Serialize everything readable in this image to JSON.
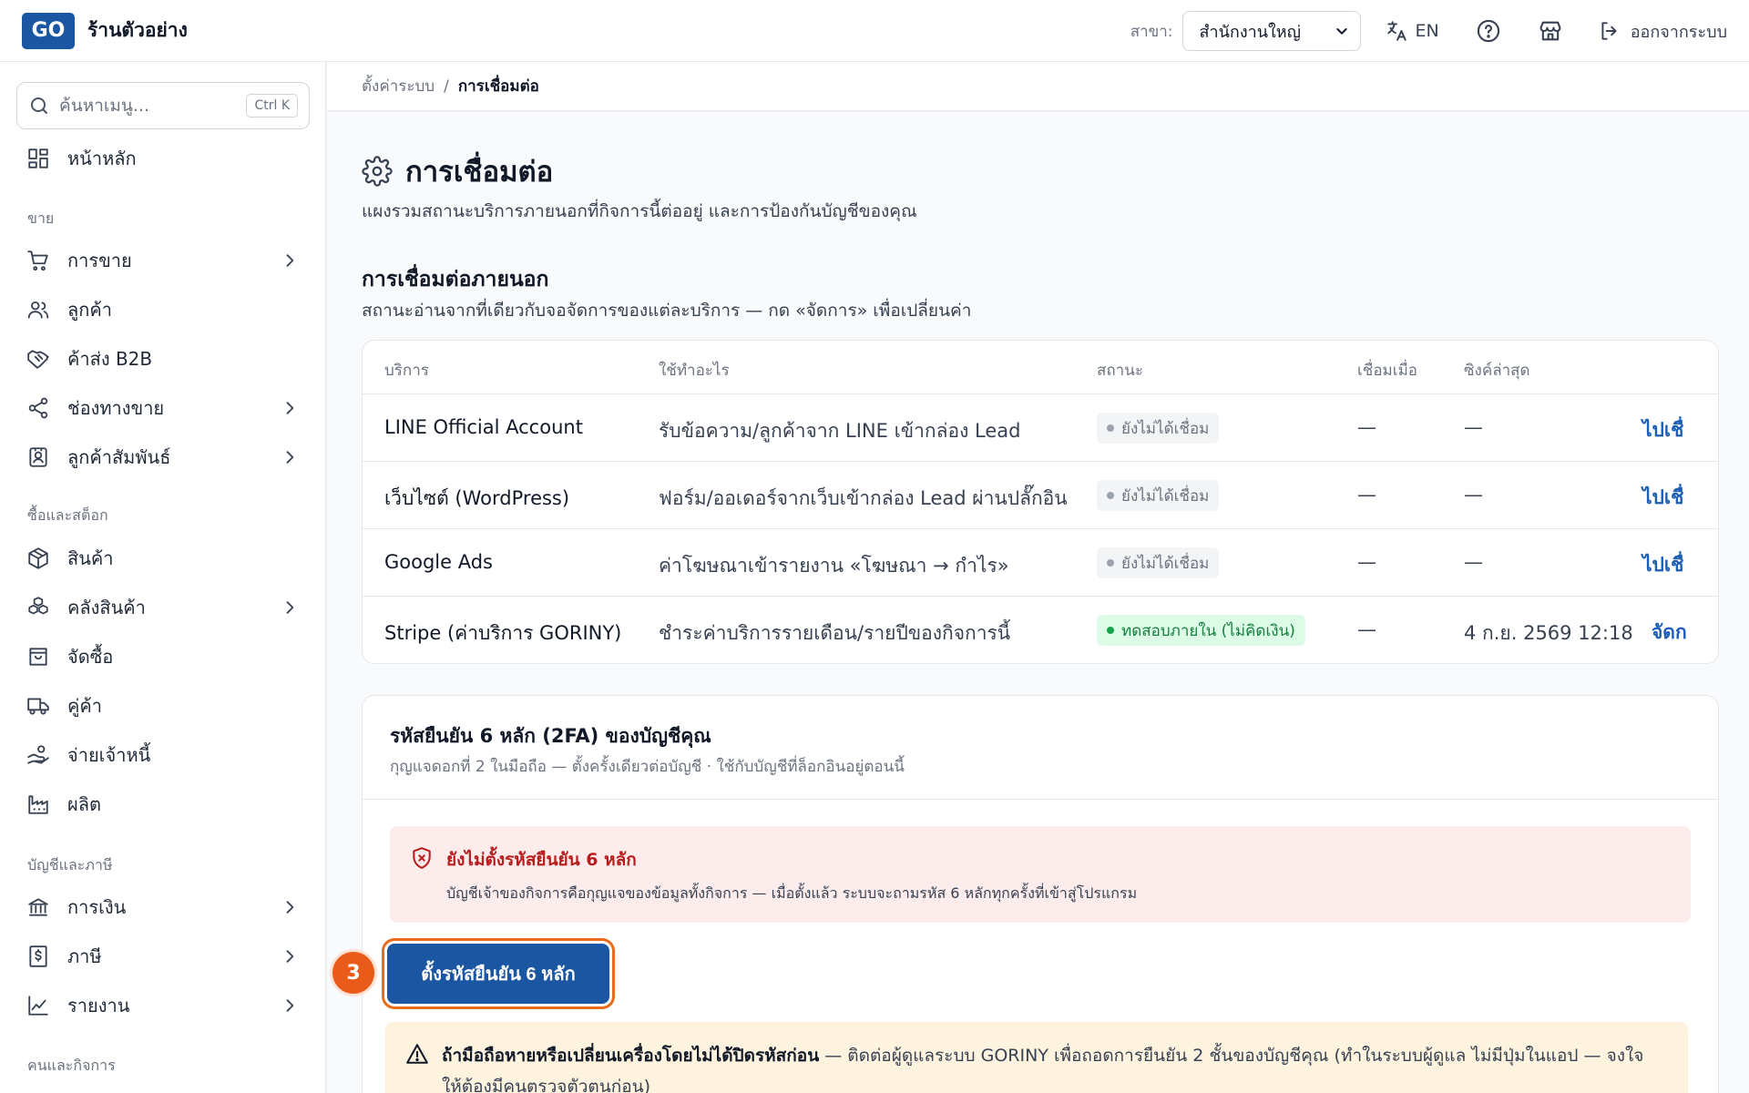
{
  "header": {
    "logo": "GO",
    "shop_name": "ร้านตัวอย่าง",
    "branch_label": "สาขา:",
    "branch_value": "สำนักงานใหญ่",
    "lang": "EN",
    "logout": "ออกจากระบบ"
  },
  "sidebar": {
    "search_placeholder": "ค้นหาเมนู...",
    "search_shortcut": "Ctrl K",
    "home": "หน้าหลัก",
    "sections": [
      "ขาย",
      "ซื้อและสต็อก",
      "บัญชีและภาษี",
      "คนและกิจการ"
    ],
    "items": [
      {
        "label": "การขาย",
        "icon": "cart-icon"
      },
      {
        "label": "ลูกค้า",
        "icon": "users-icon"
      },
      {
        "label": "ค้าส่ง B2B",
        "icon": "handshake-icon"
      },
      {
        "label": "ช่องทางขาย",
        "icon": "share-icon"
      },
      {
        "label": "ลูกค้าสัมพันธ์",
        "icon": "contact-card-icon"
      },
      {
        "label": "สินค้า",
        "icon": "box-icon"
      },
      {
        "label": "คลังสินค้า",
        "icon": "boxes-icon"
      },
      {
        "label": "จัดซื้อ",
        "icon": "bag-icon"
      },
      {
        "label": "คู่ค้า",
        "icon": "truck-icon"
      },
      {
        "label": "จ่ายเจ้าหนี้",
        "icon": "hand-coins-icon"
      },
      {
        "label": "ผลิต",
        "icon": "factory-icon"
      },
      {
        "label": "การเงิน",
        "icon": "bank-icon"
      },
      {
        "label": "ภาษี",
        "icon": "receipt-icon"
      },
      {
        "label": "รายงาน",
        "icon": "chart-line-icon"
      }
    ]
  },
  "breadcrumb": {
    "parent": "ตั้งค่าระบบ",
    "sep": "/",
    "current": "การเชื่อมต่อ"
  },
  "page": {
    "title": "การเชื่อมต่อ",
    "subtitle": "แผงรวมสถานะบริการภายนอกที่กิจการนี้ต่ออยู่ และการป้องกันบัญชีของคุณ",
    "section_title": "การเชื่อมต่อภายนอก",
    "section_sub": "สถานะอ่านจากที่เดียวกับจอจัดการของแต่ละบริการ — กด «จัดการ» เพื่อเปลี่ยนค่า"
  },
  "table": {
    "headers": [
      "บริการ",
      "ใช้ทำอะไร",
      "สถานะ",
      "เชื่อมเมื่อ",
      "ซิงค์ล่าสุด"
    ],
    "rows": [
      {
        "service": "LINE Official Account",
        "use": "รับข้อความ/ลูกค้าจาก LINE เข้ากล่อง Lead",
        "status": "ยังไม่ได้เชื่อม",
        "connected": "—",
        "synced": "—",
        "action": "ไปเชื่"
      },
      {
        "service": "เว็บไซต์ (WordPress)",
        "use": "ฟอร์ม/ออเดอร์จากเว็บเข้ากล่อง Lead ผ่านปลั๊กอิน",
        "status": "ยังไม่ได้เชื่อม",
        "connected": "—",
        "synced": "—",
        "action": "ไปเชื่"
      },
      {
        "service": "Google Ads",
        "use": "ค่าโฆษณาเข้ารายงาน «โฆษณา → กำไร»",
        "status": "ยังไม่ได้เชื่อม",
        "connected": "—",
        "synced": "—",
        "action": "ไปเชื่"
      },
      {
        "service": "Stripe (ค่าบริการ GORINY)",
        "use": "ชำระค่าบริการรายเดือน/รายปีของกิจการนี้",
        "status": "ทดสอบภายใน (ไม่คิดเงิน)",
        "connected": "—",
        "synced": "4 ก.ย. 2569 12:18",
        "action": "จัดก"
      }
    ]
  },
  "twofa": {
    "title": "รหัสยืนยัน 6 หลัก (2FA) ของบัญชีคุณ",
    "subtitle": "กุญแจดอกที่ 2 ในมือถือ — ตั้งครั้งเดียวต่อบัญชี · ใช้กับบัญชีที่ล็อกอินอยู่ตอนนี้",
    "alert_title": "ยังไม่ตั้งรหัสยืนยัน 6 หลัก",
    "alert_body": "บัญชีเจ้าของกิจการคือกุญแจของข้อมูลทั้งกิจการ — เมื่อตั้งแล้ว ระบบจะถามรหัส 6 หลักทุกครั้งที่เข้าสู่โปรแกรม",
    "button": "ตั้งรหัสยืนยัน 6 หลัก",
    "step": "3",
    "warn_bold": "ถ้ามือถือหายหรือเปลี่ยนเครื่องโดยไม่ได้ปิดรหัสก่อน",
    "warn_rest": " — ติดต่อผู้ดูแลระบบ GORINY เพื่อถอดการยืนยัน 2 ชั้นของบัญชีคุณ (ทำในระบบผู้ดูแล ไม่มีปุ่มในแอป — จงใจให้ต้องมีคนตรวจตัวตนก่อน)"
  },
  "colors": {
    "brand": "#1b56a3",
    "accent": "#ea5b1a",
    "danger": "#b91c1c",
    "success": "#15803d"
  }
}
